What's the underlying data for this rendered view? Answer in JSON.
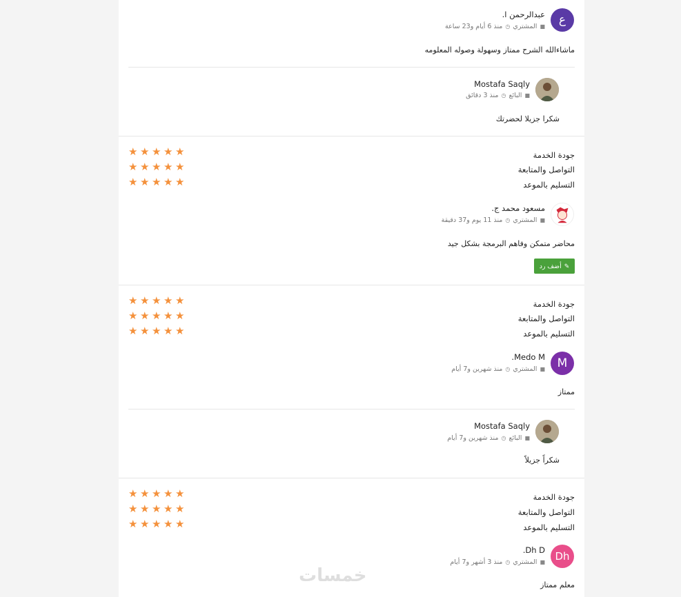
{
  "criteria": [
    "جودة الخدمة",
    "التواصل والمتابعة",
    "التسليم بالموعد"
  ],
  "colors": {
    "star": "#f4913c",
    "reply_button": "#4aa13b"
  },
  "reviews": [
    {
      "author": "عبدالرحمن ا.",
      "avatar_letter": "ع",
      "avatar_color": "#5a3aa6",
      "role": "المشتري",
      "time": "منذ 6 أيام و23 ساعة",
      "comment": "ماشاءالله الشرح ممتاز وسهولة وصوله المعلومه",
      "reply": {
        "author": "Mostafa Saqly",
        "role": "البائع",
        "time": "منذ 3 دقائق",
        "comment": "شكرا جزيلا لحضرتك"
      }
    },
    {
      "ratings": [
        5,
        5,
        5
      ],
      "author": "مسعود محمد ج.",
      "role": "المشتري",
      "time": "منذ 11 يوم و37 دقيقة",
      "comment": "محاضر متمكن وفاهم البرمجة بشكل جيد",
      "reply_button": "أضف رد"
    },
    {
      "ratings": [
        5,
        5,
        5
      ],
      "author": "Medo M.",
      "avatar_letter": "M",
      "avatar_color": "#7b2fa8",
      "role": "المشتري",
      "time": "منذ شهرين و7 أيام",
      "comment": "ممتاز",
      "reply": {
        "author": "Mostafa Saqly",
        "role": "البائع",
        "time": "منذ شهرين و7 أيام",
        "comment": "شكراً جزيلاً"
      }
    },
    {
      "ratings": [
        5,
        5,
        5
      ],
      "author": "Dh D.",
      "avatar_letter": "Dh",
      "avatar_color": "#e94e8a",
      "role": "المشتري",
      "time": "منذ 3 أشهر و7 أيام",
      "comment": "معلم ممتاز"
    }
  ],
  "watermark": "خمسات"
}
